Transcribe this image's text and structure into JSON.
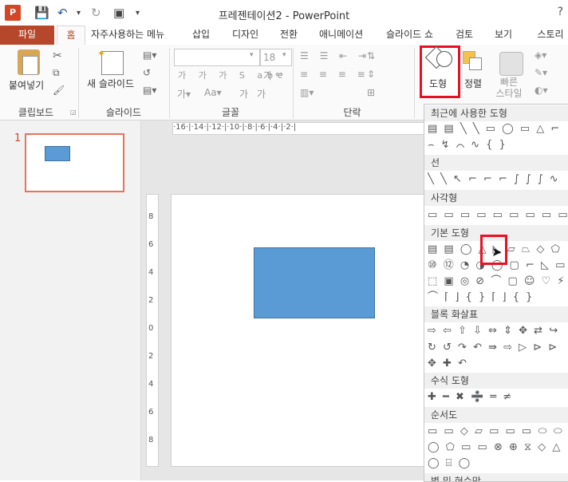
{
  "app": {
    "logo": "P",
    "title": "프레젠테이션2 - PowerPoint",
    "help": "?"
  },
  "quick_access": [
    "save-icon",
    "undo-icon",
    "redo-icon",
    "present-icon",
    "customize-icon"
  ],
  "tabs": [
    {
      "label": "파일"
    },
    {
      "label": "홈"
    },
    {
      "label": "자주사용하는 메뉴"
    },
    {
      "label": "삽입"
    },
    {
      "label": "디자인"
    },
    {
      "label": "전환"
    },
    {
      "label": "애니메이션"
    },
    {
      "label": "슬라이드 쇼"
    },
    {
      "label": "검토"
    },
    {
      "label": "보기"
    },
    {
      "label": "스토리보"
    }
  ],
  "ribbon": {
    "clipboard": {
      "paste_label": "붙여넣기",
      "group_label": "클립보드"
    },
    "slides": {
      "new_slide_label": "새 슬라이드",
      "group_label": "슬라이드"
    },
    "font": {
      "font_name": "",
      "font_size": "18",
      "group_label": "글꼴",
      "grow": "가",
      "shrink": "가",
      "clear": "가"
    },
    "paragraph": {
      "group_label": "단락"
    },
    "drawing": {
      "shapes_label": "도형",
      "arrange_label": "정렬",
      "quick_styles_label": "빠른\n스타일"
    }
  },
  "slides_panel": {
    "slide_number": "1"
  },
  "ruler": {
    "h_text": "·16·|·14·|·12·|·10·|·8·|·6·|·4·|·2·|",
    "v_ticks": [
      "8",
      "6",
      "4",
      "2",
      "0",
      "2",
      "4",
      "6",
      "8"
    ]
  },
  "gallery": {
    "sections": [
      {
        "title": "최근에 사용한 도형",
        "rows": [
          "▤ ▤ ╲ ╲ ▭ ◯ ▭ △ ⌐",
          "⌢ ↯ ⌒ ∿ { }"
        ]
      },
      {
        "title": "선",
        "rows": [
          "╲ ╲ ↖ ⌐ ⌐ ⌐ ∫ ∫ ∫ ∿"
        ]
      },
      {
        "title": "사각형",
        "rows": [
          "▭ ▭ ▭ ▭ ▭ ▭ ▭ ▭ ▭"
        ]
      },
      {
        "title": "기본 도형",
        "rows": [
          "▤ ▤ ◯ △ ◺ ▱ ⏢ ◇ ⬠",
          "⑩ ⑫ ◔ ◑ ◯ ▢ ⌐ ◺ ▭",
          "⬚ ▣ ◎ ⊘ ⌒ ▢ ☺ ♡ ⚡",
          "⌒ ⌈ ⌋ { } ⌈ ⌋ { }"
        ]
      },
      {
        "title": "블록 화살표",
        "rows": [
          "⇨ ⇦ ⇧ ⇩ ⇔ ⇕ ✥ ⇄ ↪",
          "↻ ↺ ↷ ↶ ⇛ ⇨ ▷ ⊳ ⊳",
          "✥ ✚ ↶"
        ]
      },
      {
        "title": "수식 도형",
        "rows": [
          "✚ ━ ✖ ➗ ═ ≠"
        ]
      },
      {
        "title": "순서도",
        "rows": [
          "▭ ▭ ◇ ▱ ▭ ▭ ▭ ⬭ ⬭",
          "◯ ⬠ ▭ ▭ ⊗ ⊕ ⧖ ◇ △",
          "◯ ⌸ ◯"
        ]
      },
      {
        "title": "별 및 현수막",
        "rows": []
      }
    ]
  },
  "highlight_colors": {
    "red": "#e81123",
    "accent": "#b7472a",
    "shape": "#5b9bd5"
  }
}
